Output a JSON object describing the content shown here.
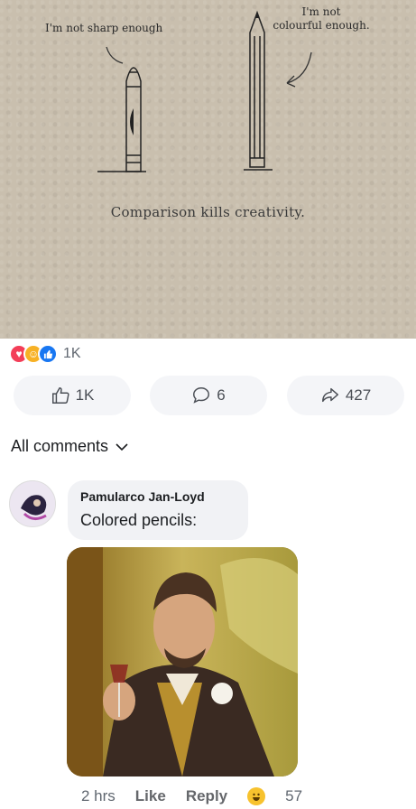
{
  "illustration": {
    "quote_left": "I'm not sharp enough",
    "quote_right_line1": "I'm not",
    "quote_right_line2": "colourful enough.",
    "caption": "Comparison kills creativity."
  },
  "reactions": {
    "count": "1K",
    "icons": [
      "heart-icon",
      "care-icon",
      "like-icon"
    ]
  },
  "actions": {
    "like": "1K",
    "comment": "6",
    "share": "427"
  },
  "comments_filter": "All comments",
  "comment": {
    "author": "Pamularco Jan-Loyd",
    "text": "Colored pencils:",
    "time": "2 hrs",
    "like_label": "Like",
    "reply_label": "Reply",
    "reaction_count": "57"
  },
  "colors": {
    "panel": "#c9bfae",
    "bubble": "#f1f2f5",
    "accent": "#1877f2"
  }
}
